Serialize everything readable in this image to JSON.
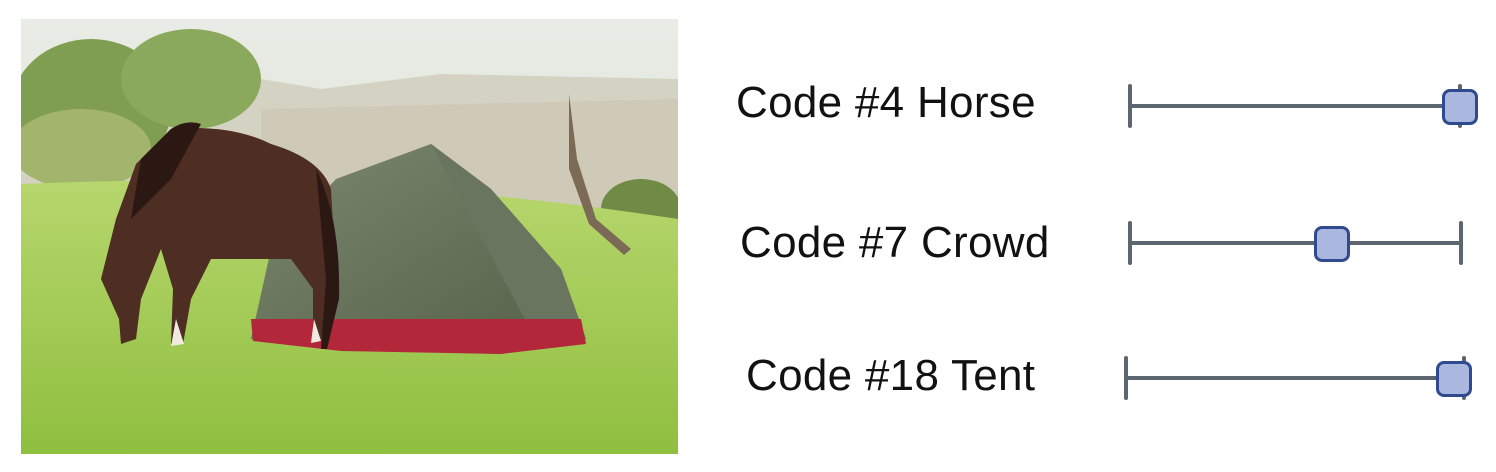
{
  "photo": {
    "subject": "horse-grazing-beside-tent"
  },
  "codes": [
    {
      "label": "Code #4 Horse",
      "value": 1.0
    },
    {
      "label": "Code #7 Crowd",
      "value": 0.61
    },
    {
      "label": "Code #18 Tent",
      "value": 0.97
    }
  ],
  "colors": {
    "track": "#5b6670",
    "thumb_fill": "#aab8e0",
    "thumb_border": "#2f4a8f"
  }
}
